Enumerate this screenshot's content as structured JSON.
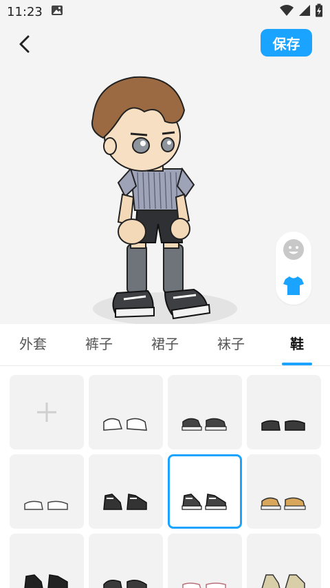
{
  "status": {
    "time": "11:23"
  },
  "header": {
    "save_label": "保存"
  },
  "tabs": [
    {
      "label": "外套"
    },
    {
      "label": "裤子"
    },
    {
      "label": "裙子"
    },
    {
      "label": "袜子"
    },
    {
      "label": "鞋",
      "active": true
    }
  ],
  "items": [
    {
      "name": "add"
    },
    {
      "name": "shoes-white-sneakers"
    },
    {
      "name": "shoes-black-white-sneakers"
    },
    {
      "name": "shoes-black-loafers"
    },
    {
      "name": "shoes-white-slippers"
    },
    {
      "name": "shoes-black-hightop"
    },
    {
      "name": "shoes-black-white-hightop",
      "selected": true
    },
    {
      "name": "shoes-tan-sneakers"
    },
    {
      "name": "shoes-black-boots"
    },
    {
      "name": "shoes-dark-boots"
    },
    {
      "name": "shoes-pink-sandals"
    },
    {
      "name": "shoes-beige-boots"
    }
  ],
  "colors": {
    "accent": "#1aa3ff"
  }
}
